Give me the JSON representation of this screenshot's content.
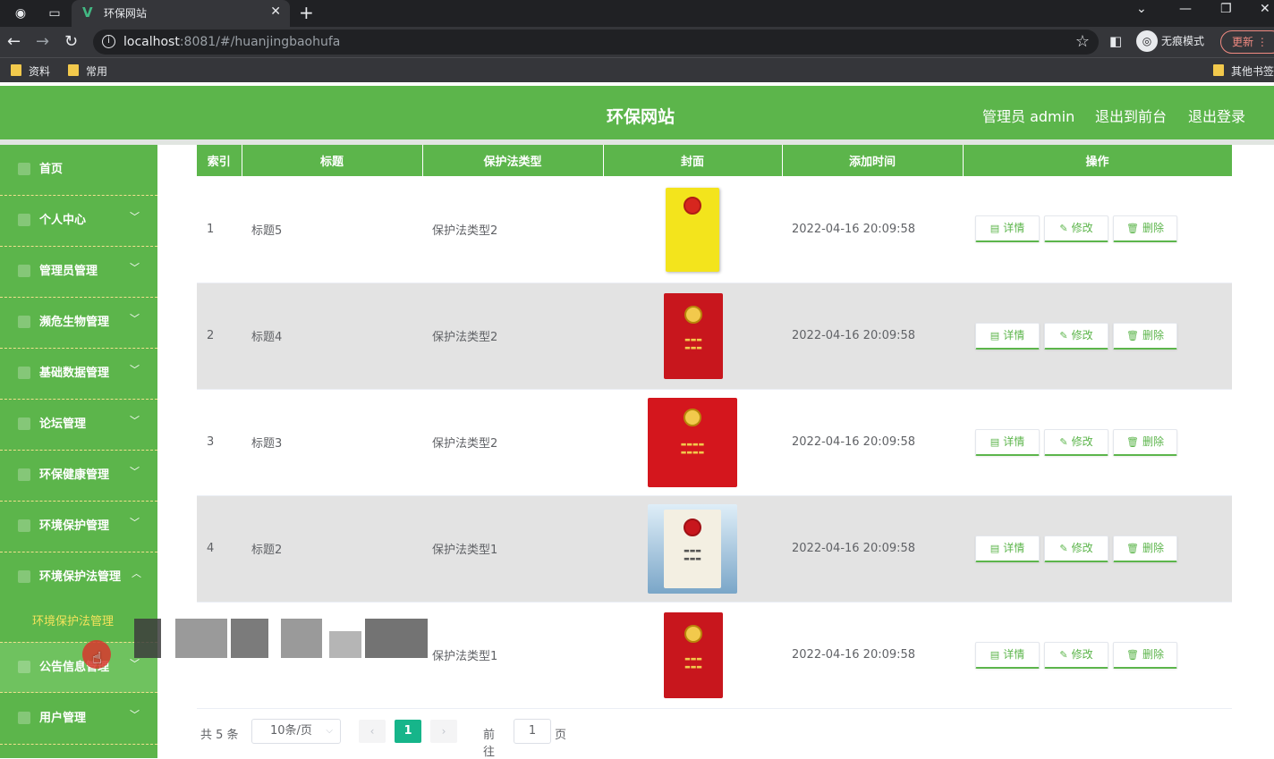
{
  "browser": {
    "tab_title": "环保网站",
    "url_host": "localhost",
    "url_rest": ":8081/#/huanjingbaohufa",
    "incognito_label": "无痕模式",
    "update_label": "更新",
    "bookmarks": [
      "资料",
      "常用"
    ],
    "other_bookmarks": "其他书签"
  },
  "header": {
    "title": "环保网站",
    "admin_label": "管理员 admin",
    "front_label": "退出到前台",
    "logout_label": "退出登录"
  },
  "sidebar": {
    "items": [
      {
        "label": "首页"
      },
      {
        "label": "个人中心"
      },
      {
        "label": "管理员管理"
      },
      {
        "label": "濒危生物管理"
      },
      {
        "label": "基础数据管理"
      },
      {
        "label": "论坛管理"
      },
      {
        "label": "环保健康管理"
      },
      {
        "label": "环境保护管理"
      },
      {
        "label": "环境保护法管理"
      },
      {
        "label": "公告信息管理"
      },
      {
        "label": "用户管理"
      }
    ],
    "active_sub": "环境保护法管理"
  },
  "table": {
    "headers": [
      "索引",
      "标题",
      "保护法类型",
      "封面",
      "添加时间",
      "操作"
    ],
    "rows": [
      {
        "index": "1",
        "title": "标题5",
        "type": "保护法类型2",
        "time": "2022-04-16 20:09:58",
        "cover": "yellow"
      },
      {
        "index": "2",
        "title": "标题4",
        "type": "保护法类型2",
        "time": "2022-04-16 20:09:58",
        "cover": "red"
      },
      {
        "index": "3",
        "title": "标题3",
        "type": "保护法类型2",
        "time": "2022-04-16 20:09:58",
        "cover": "red-wide"
      },
      {
        "index": "4",
        "title": "标题2",
        "type": "保护法类型1",
        "time": "2022-04-16 20:09:58",
        "cover": "white"
      },
      {
        "index": "",
        "title": "",
        "type": "保护法类型1",
        "time": "2022-04-16 20:09:58",
        "cover": "red"
      }
    ],
    "actions": {
      "detail": "详情",
      "edit": "修改",
      "delete": "删除"
    }
  },
  "pagination": {
    "total": "共 5 条",
    "page_size": "10条/页",
    "current": "1",
    "goto_label": "前往",
    "goto_value": "1",
    "page_label": "页"
  },
  "colors": {
    "primary": "#5cb54b",
    "accent": "#16b58a",
    "submenu_text": "#f4e35c"
  }
}
